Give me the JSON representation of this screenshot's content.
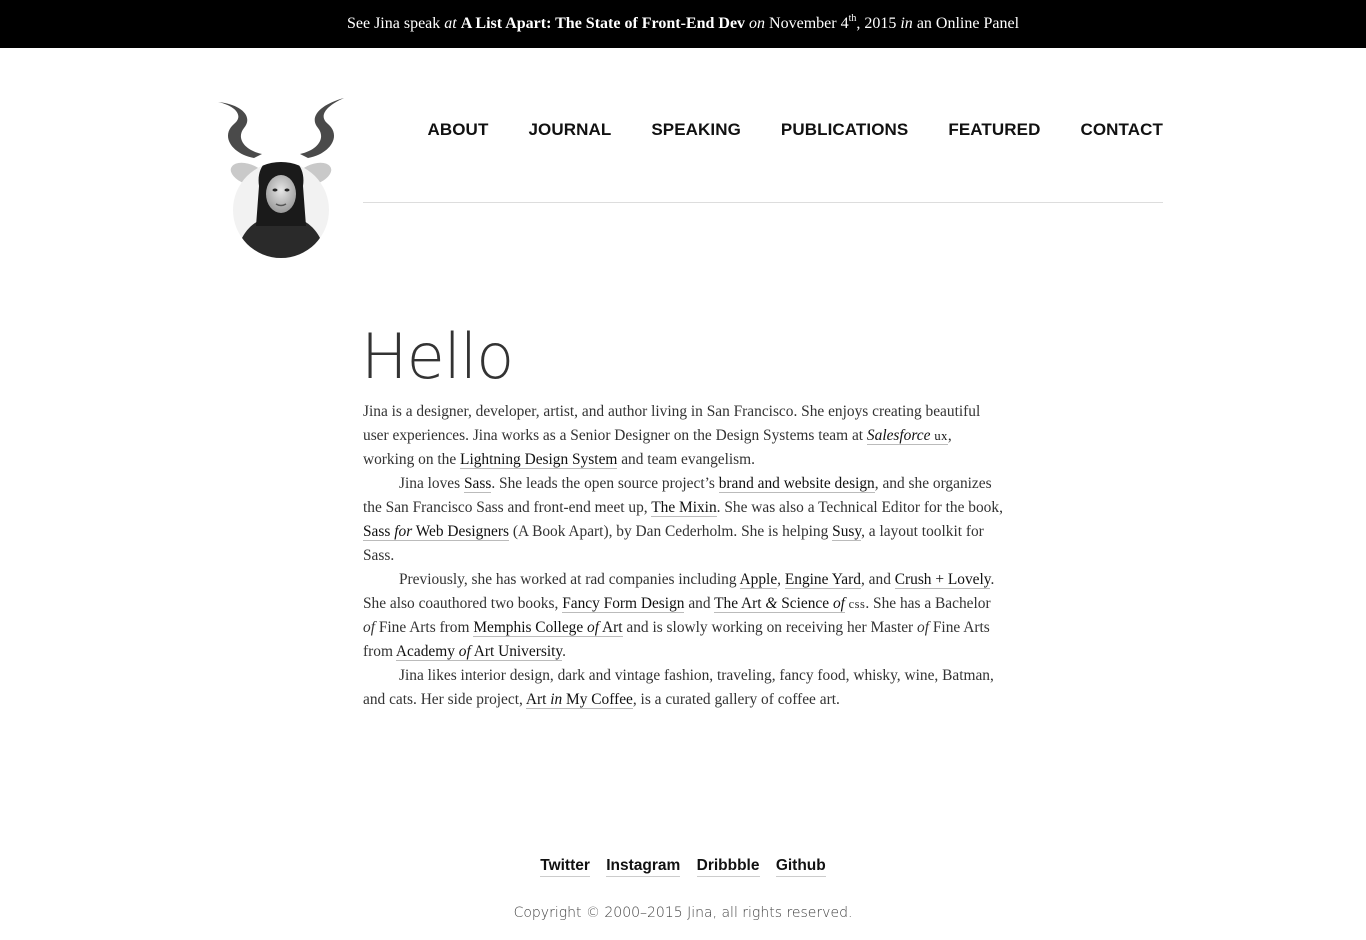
{
  "banner": {
    "part1": "See Jina speak ",
    "at": "at",
    "event": "A List Apart: The State of Front-End Dev",
    "on": "on",
    "date_prefix": " November 4",
    "date_sup": "th",
    "date_suffix": ", 2015 ",
    "in": "in",
    "location": " an Online Panel"
  },
  "nav": {
    "items": [
      "ABOUT",
      "JOURNAL",
      "SPEAKING",
      "PUBLICATIONS",
      "FEATURED",
      "CONTACT"
    ]
  },
  "main": {
    "title": "Hello",
    "p1": {
      "t1": "Jina is a designer, developer, artist, and author living in San Francisco. She enjoys creating beautiful user experiences. Jina works as a Senior Designer on the Design Systems team at ",
      "salesforce": "Salesforce",
      "ux": "ux",
      "t2": ", working on the ",
      "lds": "Lightning Design System",
      "t3": " and team evangelism."
    },
    "p2": {
      "t1": "Jina loves ",
      "sass": "Sass",
      "t2": ". She leads the open source project’s ",
      "brand": "brand and website design",
      "t3": ", and she organizes the San Francisco Sass and front-end meet up, ",
      "mixin": "The Mixin",
      "t4": ". She was also a Technical Editor for the book, ",
      "book_a": "Sass ",
      "book_for": "for",
      "book_b": " Web Designers",
      "t5": " (A Book Apart), by Dan Cederholm. She is helping ",
      "susy": "Susy",
      "t6": ", a layout toolkit for Sass."
    },
    "p3": {
      "t1": "Previously, she has worked at rad companies including ",
      "apple": "Apple",
      "t2": ", ",
      "engine": "Engine Yard",
      "t3": ", and ",
      "crush": "Crush + Lovely",
      "t4": ". She also coauthored two books, ",
      "fancy": "Fancy Form Design",
      "t5": " and ",
      "art_a": "The Art ",
      "art_amp": "&",
      "art_b": " Science ",
      "art_of": "of",
      "art_css": " css",
      "t6": ". She has a Bachelor ",
      "of1": "of",
      "t7": " Fine Arts from ",
      "memphis_a": "Memphis College ",
      "memphis_of": "of",
      "memphis_b": " Art",
      "t8": " and is slowly working on receiving her Master ",
      "of2": "of",
      "t9": " Fine Arts from ",
      "academy_a": "Academy ",
      "academy_of": "of",
      "academy_b": " Art University",
      "t10": "."
    },
    "p4": {
      "t1": "Jina likes interior design, dark and vintage fashion, traveling, fancy food, whisky, wine, Batman, and cats. Her side project, ",
      "aimc_a": "Art ",
      "aimc_in": "in",
      "aimc_b": " My Coffee",
      "t2": ", is a curated gallery of coffee art."
    }
  },
  "footer": {
    "social": [
      "Twitter",
      "Instagram",
      "Dribbble",
      "Github"
    ],
    "copyright": "Copyright © 2000–2015 Jina, all rights reserved."
  }
}
